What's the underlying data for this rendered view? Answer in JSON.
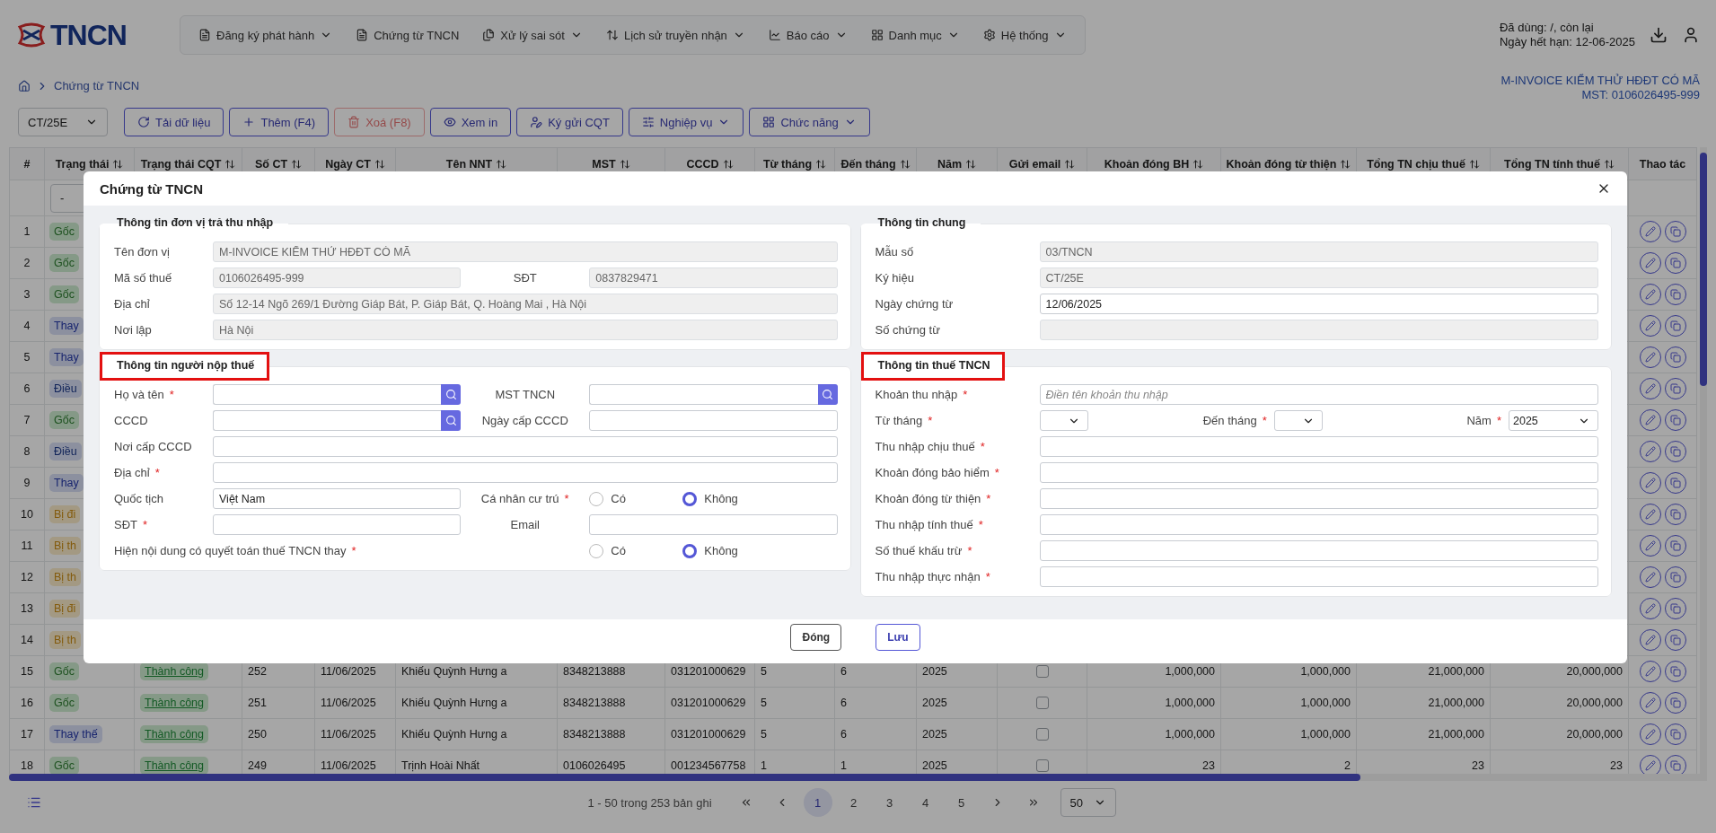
{
  "header": {
    "logo": "TNCN",
    "nav": [
      {
        "label": "Đăng ký phát hành",
        "dropdown": true
      },
      {
        "label": "Chứng từ TNCN",
        "dropdown": false
      },
      {
        "label": "Xử lý sai sót",
        "dropdown": true
      },
      {
        "label": "Lịch sử truyền nhận",
        "dropdown": true
      },
      {
        "label": "Báo cáo",
        "dropdown": true
      },
      {
        "label": "Danh mục",
        "dropdown": true
      },
      {
        "label": "Hệ thống",
        "dropdown": true
      }
    ],
    "usage": "Đã dùng: /, còn lại",
    "expiry": "Ngày hết hạn: 12-06-2025"
  },
  "breadcrumb": {
    "current": "Chứng từ TNCN",
    "company": "M-INVOICE KIỂM THỬ HĐĐT CÓ MÃ",
    "tax_code": "MST: 0106026495-999"
  },
  "toolbar": {
    "series": "CT/25E",
    "buttons": [
      {
        "label": "Tải dữ liệu",
        "disabled": false,
        "dropdown": false
      },
      {
        "label": "Thêm (F4)",
        "disabled": false,
        "dropdown": false
      },
      {
        "label": "Xoá (F8)",
        "disabled": true,
        "dropdown": false
      },
      {
        "label": "Xem in",
        "disabled": false,
        "dropdown": false
      },
      {
        "label": "Ký gửi CQT",
        "disabled": false,
        "dropdown": false
      },
      {
        "label": "Nghiệp vụ",
        "disabled": false,
        "dropdown": true
      },
      {
        "label": "Chức năng",
        "disabled": false,
        "dropdown": true
      }
    ]
  },
  "table": {
    "columns": [
      {
        "label": "#",
        "sortable": false
      },
      {
        "label": "Trạng thái",
        "sortable": true
      },
      {
        "label": "Trạng thái CQT",
        "sortable": true
      },
      {
        "label": "Số CT",
        "sortable": true
      },
      {
        "label": "Ngày CT",
        "sortable": true
      },
      {
        "label": "Tên NNT",
        "sortable": true
      },
      {
        "label": "MST",
        "sortable": true
      },
      {
        "label": "CCCD",
        "sortable": true
      },
      {
        "label": "Từ tháng",
        "sortable": true
      },
      {
        "label": "Đến tháng",
        "sortable": true
      },
      {
        "label": "Năm",
        "sortable": true
      },
      {
        "label": "Gửi email",
        "sortable": true
      },
      {
        "label": "Khoản đóng BH",
        "sortable": true
      },
      {
        "label": "Khoản đóng từ thiện",
        "sortable": true
      },
      {
        "label": "Tổng TN chịu thuế",
        "sortable": true
      },
      {
        "label": "Tổng TN tính thuế",
        "sortable": true
      },
      {
        "label": "Thao tác",
        "sortable": false
      }
    ],
    "filter": {
      "status": "-"
    },
    "rows": [
      {
        "index": "1",
        "status": {
          "text": "Gốc",
          "kind": "original"
        }
      },
      {
        "index": "2",
        "status": {
          "text": "Gốc",
          "kind": "original"
        }
      },
      {
        "index": "3",
        "status": {
          "text": "Gốc",
          "kind": "original"
        }
      },
      {
        "index": "4",
        "status": {
          "text": "Thay",
          "kind": "replacement"
        }
      },
      {
        "index": "5",
        "status": {
          "text": "Thay",
          "kind": "replacement"
        }
      },
      {
        "index": "6",
        "status": {
          "text": "Điều",
          "kind": "adjustment"
        }
      },
      {
        "index": "7",
        "status": {
          "text": "Gốc",
          "kind": "original"
        }
      },
      {
        "index": "8",
        "status": {
          "text": "Điều",
          "kind": "adjustment"
        }
      },
      {
        "index": "9",
        "status": {
          "text": "Thay",
          "kind": "replacement"
        }
      },
      {
        "index": "10",
        "status": {
          "text": "Bị đi",
          "kind": "affected"
        }
      },
      {
        "index": "11",
        "status": {
          "text": "Bị th",
          "kind": "affected"
        }
      },
      {
        "index": "12",
        "status": {
          "text": "Bị th",
          "kind": "affected"
        }
      },
      {
        "index": "13",
        "status": {
          "text": "Bị đi",
          "kind": "affected"
        }
      },
      {
        "index": "14",
        "status": {
          "text": "Bị th",
          "kind": "affected"
        }
      },
      {
        "index": "15",
        "status": {
          "text": "Gốc",
          "kind": "original"
        },
        "cqt_status": "Thành công",
        "number": "252",
        "date": "11/06/2025",
        "name": "Khiếu Quỳnh Hưng a",
        "tax_code": "8348213888",
        "id_number": "031201000629",
        "from_month": "5",
        "to_month": "6",
        "year": "2025",
        "send_email": false,
        "insurance": "1,000,000",
        "charity": "1,000,000",
        "taxable_income": "21,000,000",
        "assessable_income": "20,000,000"
      },
      {
        "index": "16",
        "status": {
          "text": "Gốc",
          "kind": "original"
        },
        "cqt_status": "Thành công",
        "number": "251",
        "date": "11/06/2025",
        "name": "Khiếu Quỳnh Hưng a",
        "tax_code": "8348213888",
        "id_number": "031201000629",
        "from_month": "5",
        "to_month": "6",
        "year": "2025",
        "send_email": false,
        "insurance": "1,000,000",
        "charity": "1,000,000",
        "taxable_income": "21,000,000",
        "assessable_income": "20,000,000"
      },
      {
        "index": "17",
        "status": {
          "text": "Thay thế",
          "kind": "replacement"
        },
        "cqt_status": "Thành công",
        "number": "250",
        "date": "11/06/2025",
        "name": "Khiếu Quỳnh Hưng a",
        "tax_code": "8348213888",
        "id_number": "031201000629",
        "from_month": "5",
        "to_month": "6",
        "year": "2025",
        "send_email": false,
        "insurance": "1,000,000",
        "charity": "1,000,000",
        "taxable_income": "21,000,000",
        "assessable_income": "20,000,000"
      },
      {
        "index": "18",
        "status": {
          "text": "Gốc",
          "kind": "original"
        },
        "cqt_status": "Thành công",
        "number": "249",
        "date": "11/06/2025",
        "name": "Trịnh Hoài Nhất",
        "tax_code": "0106026495",
        "id_number": "001234567758",
        "from_month": "1",
        "to_month": "1",
        "year": "2025",
        "send_email": false,
        "insurance": "23",
        "charity": "2",
        "taxable_income": "23",
        "assessable_income": "23"
      }
    ]
  },
  "pagination": {
    "summary": "1 - 50 trong 253 bản ghi",
    "pages": [
      {
        "label": "1",
        "selected": true
      },
      {
        "label": "2",
        "selected": false
      },
      {
        "label": "3",
        "selected": false
      },
      {
        "label": "4",
        "selected": false
      },
      {
        "label": "5",
        "selected": false
      }
    ],
    "page_size": "50"
  },
  "dialog": {
    "title": "Chứng từ TNCN",
    "left_sections": [
      {
        "title": "Thông tin đơn vị trả thu nhập",
        "highlighted": false,
        "rows": [
          [
            {
              "label": "Tên đơn vị",
              "kind": "text",
              "value": "M-INVOICE KIỂM THỬ HĐĐT CÓ MÃ",
              "disabled": true
            }
          ],
          [
            {
              "label": "Mã số thuế",
              "kind": "text",
              "value": "0106026495-999",
              "disabled": true
            },
            {
              "label": "SĐT",
              "kind": "text",
              "value": "0837829471",
              "disabled": true
            }
          ],
          [
            {
              "label": "Địa chỉ",
              "kind": "text",
              "value": "Số 12-14 Ngõ 269/1 Đường Giáp Bát, P. Giáp Bát, Q. Hoàng Mai , Hà Nội",
              "disabled": true
            }
          ],
          [
            {
              "label": "Nơi lập",
              "kind": "text",
              "value": "Hà Nội",
              "disabled": true
            }
          ]
        ]
      },
      {
        "title": "Thông tin người nộp thuế",
        "highlighted": true,
        "rows": [
          [
            {
              "label": "Họ và tên",
              "mark": "*",
              "kind": "search"
            },
            {
              "label": "MST TNCN",
              "kind": "search"
            }
          ],
          [
            {
              "label": "CCCD",
              "kind": "search"
            },
            {
              "label": "Ngày cấp CCCD",
              "kind": "text",
              "disabled": false
            }
          ],
          [
            {
              "label": "Nơi cấp CCCD",
              "kind": "text",
              "disabled": false
            }
          ],
          [
            {
              "label": "Địa chỉ",
              "mark": "*",
              "kind": "text",
              "disabled": false
            }
          ],
          [
            {
              "label": "Quốc tịch",
              "kind": "text",
              "value": "Việt Nam",
              "disabled": false
            },
            {
              "label": "Cá nhân cư trú",
              "mark": "*",
              "kind": "radio",
              "options": [
                {
                  "label": "Có",
                  "selected": false
                },
                {
                  "label": "Không",
                  "selected": true
                }
              ]
            }
          ],
          [
            {
              "label": "SĐT",
              "mark": "*",
              "kind": "text",
              "disabled": false
            },
            {
              "label": "Email",
              "kind": "text",
              "disabled": false
            }
          ],
          [
            {
              "label": "Hiện nội dung có quyết toán thuế TNCN thay",
              "mark": "*",
              "kind": "radio",
              "options": [
                {
                  "label": "Có",
                  "selected": false
                },
                {
                  "label": "Không",
                  "selected": true
                }
              ]
            }
          ]
        ]
      }
    ],
    "right_sections": [
      {
        "title": "Thông tin chung",
        "highlighted": false,
        "rows": [
          [
            {
              "label": "Mẫu số",
              "kind": "text",
              "value": "03/TNCN",
              "disabled": true
            }
          ],
          [
            {
              "label": "Ký hiệu",
              "kind": "text",
              "value": "CT/25E",
              "disabled": true
            }
          ],
          [
            {
              "label": "Ngày chứng từ",
              "kind": "text",
              "value": "12/06/2025",
              "disabled": false
            }
          ],
          [
            {
              "label": "Số chứng từ",
              "kind": "text",
              "disabled": true
            }
          ]
        ]
      },
      {
        "title": "Thông tin thuế TNCN",
        "highlighted": true,
        "rows": [
          [
            {
              "label": "Khoản thu nhập",
              "mark": "*",
              "kind": "text",
              "placeholder": "Điền tên khoản thu nhập",
              "disabled": false
            }
          ],
          [
            {
              "label": "Từ tháng",
              "mark": "*",
              "kind": "select"
            },
            {
              "label": "Đến tháng",
              "mark": "*",
              "kind": "select"
            },
            {
              "label": "Năm",
              "mark": "*",
              "kind": "select",
              "value": "2025"
            }
          ],
          [
            {
              "label": "Thu nhập chịu thuế",
              "mark": "*",
              "kind": "text",
              "disabled": false
            }
          ],
          [
            {
              "label": "Khoản đóng bảo hiểm",
              "mark": "*",
              "kind": "text",
              "disabled": false
            }
          ],
          [
            {
              "label": "Khoản đóng từ thiện",
              "mark": "*",
              "kind": "text",
              "disabled": false
            }
          ],
          [
            {
              "label": "Thu nhập tính thuế",
              "mark": "*",
              "kind": "text",
              "disabled": false
            }
          ],
          [
            {
              "label": "Số thuế khấu trừ",
              "mark": "*",
              "kind": "text",
              "disabled": false
            }
          ],
          [
            {
              "label": "Thu nhập thực nhận",
              "mark": "*",
              "kind": "text",
              "disabled": false
            }
          ]
        ]
      }
    ],
    "buttons": [
      {
        "label": "Đóng",
        "kind": "secondary"
      },
      {
        "label": "Lưu",
        "kind": "primary"
      }
    ]
  }
}
